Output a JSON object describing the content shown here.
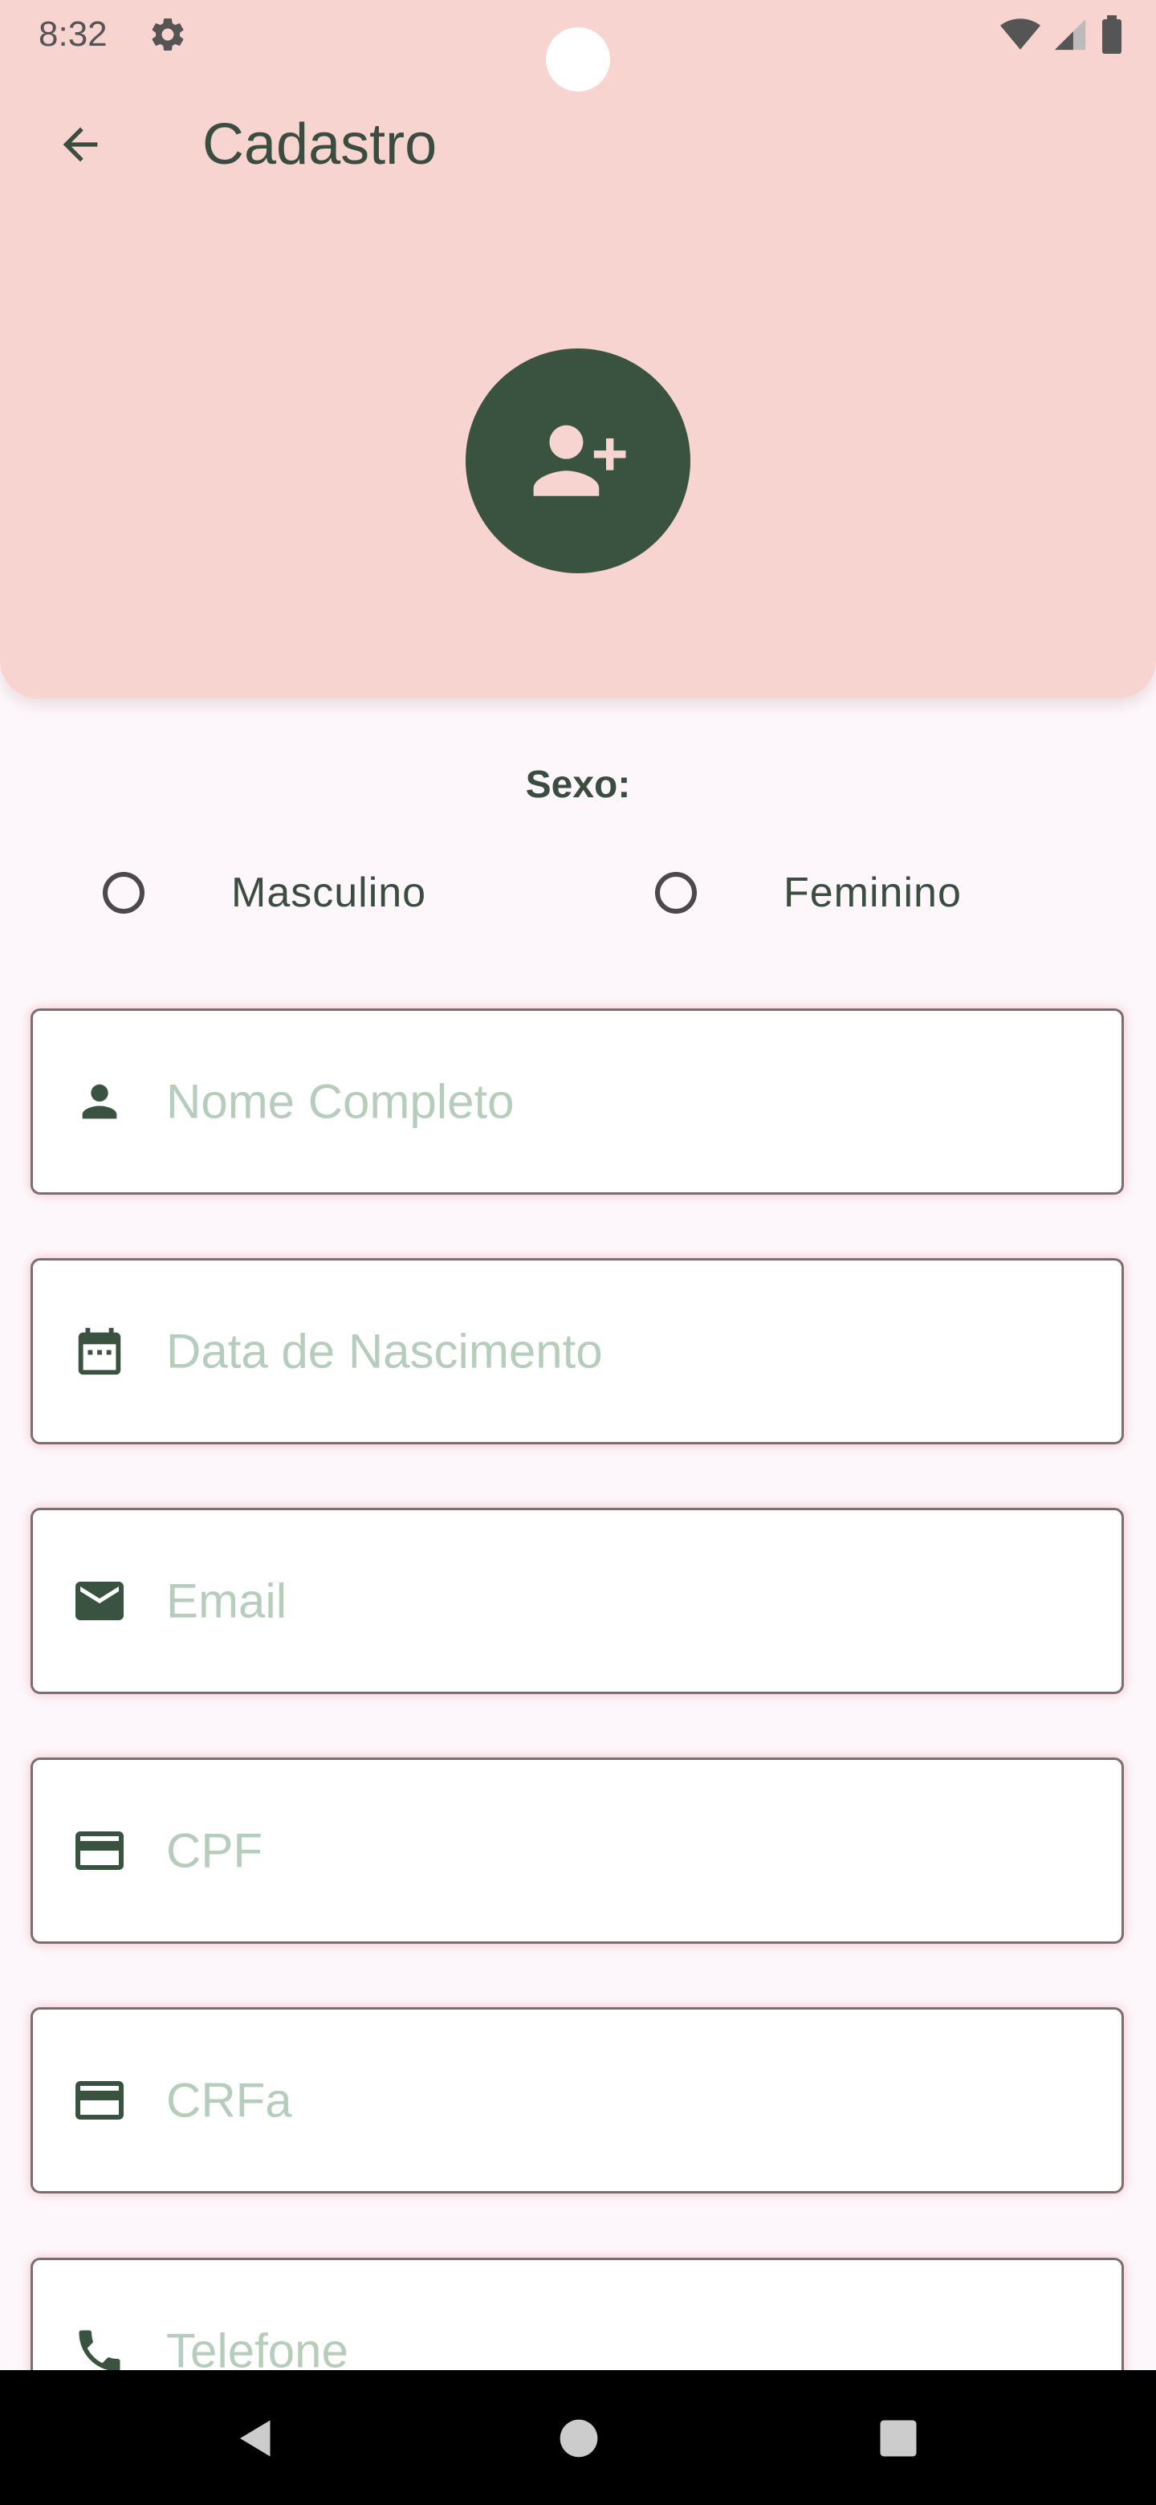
{
  "status_bar": {
    "time": "8:32"
  },
  "header": {
    "title": "Cadastro"
  },
  "form": {
    "sexo_label": "Sexo:",
    "radio_options": [
      {
        "label": "Masculino"
      },
      {
        "label": "Feminino"
      }
    ],
    "fields": [
      {
        "placeholder": "Nome Completo",
        "icon": "person-icon"
      },
      {
        "placeholder": "Data de Nascimento",
        "icon": "calendar-icon"
      },
      {
        "placeholder": "Email",
        "icon": "email-icon"
      },
      {
        "placeholder": "CPF",
        "icon": "card-icon"
      },
      {
        "placeholder": "CRFa",
        "icon": "card-icon"
      },
      {
        "placeholder": "Telefone",
        "icon": "phone-icon"
      }
    ]
  },
  "colors": {
    "header_bg": "#f8d4d0",
    "accent": "#3a5340",
    "placeholder": "#b7cdbc",
    "background": "#fdf7fb"
  }
}
